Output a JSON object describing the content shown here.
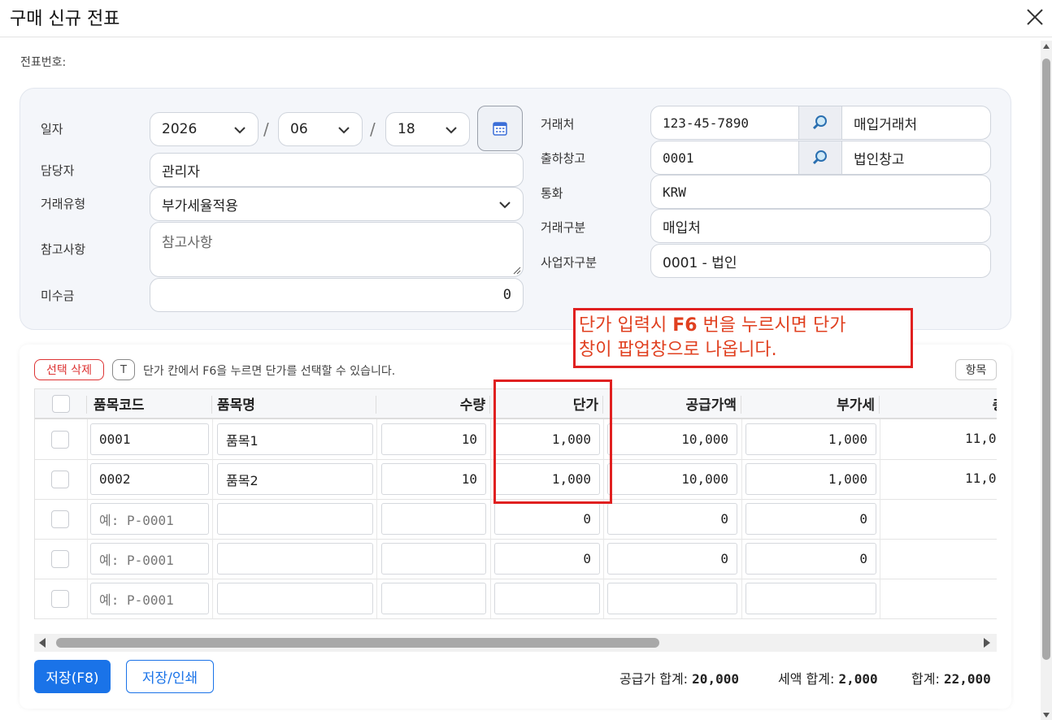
{
  "window": {
    "title": "구매 신규 전표"
  },
  "voucher_label": "전표번호:",
  "form": {
    "date_label": "일자",
    "year": "2026",
    "month": "06",
    "day": "18",
    "date_sep": "/",
    "manager_label": "담당자",
    "manager": "관리자",
    "trade_type_label": "거래유형",
    "trade_type": "부가세율적용",
    "memo_label": "참고사항",
    "memo_placeholder": "참고사항",
    "unpaid_label": "미수금",
    "unpaid": "0",
    "vendor_label": "거래처",
    "vendor_code": "123-45-7890",
    "vendor_name": "매입거래처",
    "warehouse_label": "출하창고",
    "warehouse_code": "0001",
    "warehouse_name": "법인창고",
    "currency_label": "통화",
    "currency": "KRW",
    "trade_class_label": "거래구분",
    "trade_class": "매입처",
    "biz_class_label": "사업자구분",
    "biz_class": "0001 - 법인"
  },
  "grid": {
    "delete_button": "선택 삭제",
    "t_button": "T",
    "hint": "단가 칸에서 F6을 누르면 단가를 선택할 수 있습니다.",
    "items_button": "항목",
    "columns": [
      "품목코드",
      "품목명",
      "수량",
      "단가",
      "공급가액",
      "부가세",
      "총금"
    ],
    "code_placeholder": "예: P-0001",
    "rows": [
      {
        "code": "0001",
        "name": "품목1",
        "qty": "10",
        "price": "1,000",
        "supply": "10,000",
        "vat": "1,000",
        "total": "11,0"
      },
      {
        "code": "0002",
        "name": "품목2",
        "qty": "10",
        "price": "1,000",
        "supply": "10,000",
        "vat": "1,000",
        "total": "11,0"
      },
      {
        "code": "",
        "name": "",
        "qty": "",
        "price": "0",
        "supply": "0",
        "vat": "0",
        "total": ""
      },
      {
        "code": "",
        "name": "",
        "qty": "",
        "price": "0",
        "supply": "0",
        "vat": "0",
        "total": ""
      },
      {
        "code": "",
        "name": "",
        "qty": "",
        "price": "",
        "supply": "",
        "vat": "",
        "total": ""
      }
    ]
  },
  "footer": {
    "save_button": "저장(F8)",
    "save_print_button": "저장/인쇄",
    "supply_total_label": "공급가 합계:",
    "supply_total": "20,000",
    "vat_total_label": "세액 합계:",
    "vat_total": "2,000",
    "grand_total_label": "합계:",
    "grand_total": "22,000"
  },
  "annotation": {
    "line1_prefix": "단가 입력시 ",
    "line1_key": "F6",
    "line1_suffix": " 번을 누르시면 단가",
    "line2": "창이 팝업창으로 나옵니다."
  },
  "colors": {
    "primary": "#1a73e8",
    "danger": "#d33333",
    "annotation": "#e02020"
  }
}
